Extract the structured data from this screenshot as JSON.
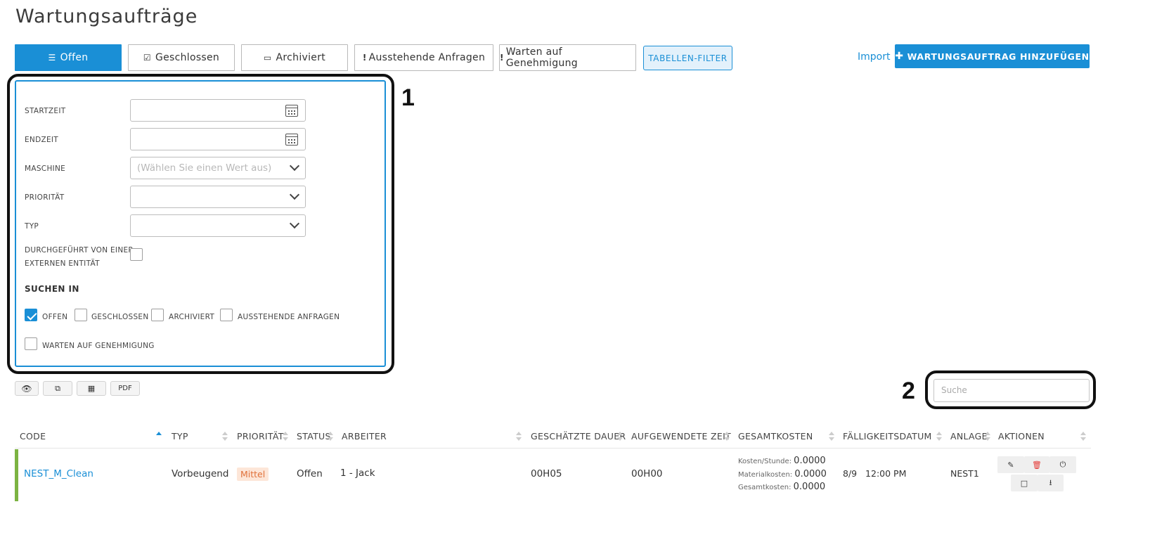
{
  "page": {
    "title": "Wartungsaufträge"
  },
  "tabs": [
    {
      "label": "Offen",
      "icon": "list-icon"
    },
    {
      "label": "Geschlossen",
      "icon": "edit-check-icon"
    },
    {
      "label": "Archiviert",
      "icon": "inbox-icon"
    },
    {
      "label": "Ausstehende Anfragen",
      "icon": "exclamation-icon"
    },
    {
      "label": "Warten auf Genehmigung",
      "icon": "exclamation-icon"
    },
    {
      "label": "TABELLEN-FILTER"
    }
  ],
  "header": {
    "import_label": "Import",
    "add_label": "WARTUNGSAUFTRAG HINZUFÜGEN"
  },
  "callouts": {
    "one": "1",
    "two": "2"
  },
  "filter": {
    "start_label": "STARTZEIT",
    "end_label": "ENDZEIT",
    "machine_label": "MASCHINE",
    "machine_placeholder": "(Wählen Sie einen Wert aus)",
    "priority_label": "PRIORITÄT",
    "type_label": "TYP",
    "external_label_line1": "DURCHGEFÜHRT VON EINER",
    "external_label_line2": "EXTERNEN ENTITÄT",
    "search_in_label": "SUCHEN IN",
    "search_in": [
      {
        "label": "OFFEN",
        "checked": true
      },
      {
        "label": "GESCHLOSSEN",
        "checked": false
      },
      {
        "label": "ARCHIVIERT",
        "checked": false
      },
      {
        "label": "AUSSTEHENDE ANFRAGEN",
        "checked": false
      },
      {
        "label": "WARTEN AUF GENEHMIGUNG",
        "checked": false
      }
    ]
  },
  "toolbar": {
    "pdf_label": "PDF"
  },
  "search": {
    "placeholder": "Suche"
  },
  "table": {
    "columns": [
      "CODE",
      "TYP",
      "PRIORITÄT",
      "STATUS",
      "ARBEITER",
      "GESCHÄTZTE DAUER",
      "AUFGEWENDETE ZEIT",
      "GESAMTKOSTEN",
      "FÄLLIGKEITSDATUM",
      "ANLAGE",
      "AKTIONEN"
    ],
    "rows": [
      {
        "code": "NEST_M_Clean",
        "type": "Vorbeugend",
        "priority": "Mittel",
        "status": "Offen",
        "worker": "1 - Jack",
        "estimated_duration": "00H05",
        "time_spent": "00H00",
        "cost_per_hour_label": "Kosten/Stunde:",
        "cost_per_hour": "0.0000",
        "material_cost_label": "Materialkosten:",
        "material_cost": "0.0000",
        "total_cost_label": "Gesamtkosten:",
        "total_cost": "0.0000",
        "due_date": "8/9   12:00 PM",
        "asset": "NEST1"
      }
    ]
  },
  "colors": {
    "accent": "#1a8fd6",
    "row_stripe": "#7cb342",
    "priority_bg": "#fde6d8",
    "priority_fg": "#e0713a"
  }
}
